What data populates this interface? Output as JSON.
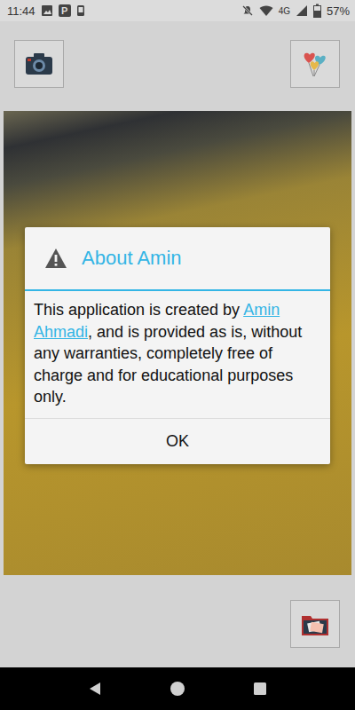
{
  "status_bar": {
    "time": "11:44",
    "notification_letter": "P",
    "network": "4G",
    "battery": "57%",
    "battery_level": 0.57
  },
  "dialog": {
    "title": "About Amin",
    "message_before": "This application is created by ",
    "link": "Amin Ahmadi",
    "message_after": ", and is provided as is, without any warranties, completely free of charge and for educational purposes only.",
    "buttons": [
      "OK"
    ]
  }
}
